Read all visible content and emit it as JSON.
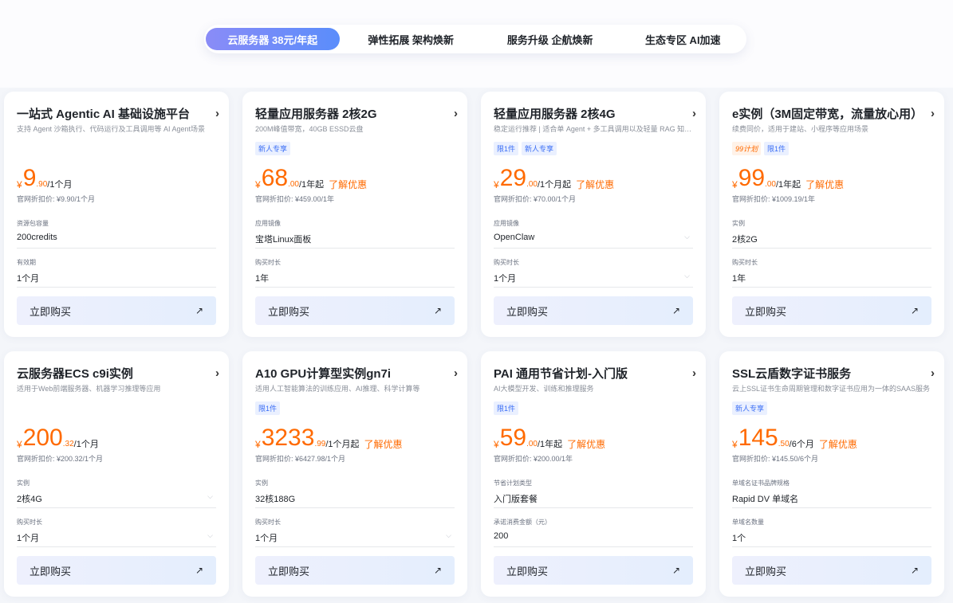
{
  "tabs": [
    {
      "label": "云服务器 38元/年起",
      "active": true
    },
    {
      "label": "弹性拓展 架构焕新",
      "active": false
    },
    {
      "label": "服务升级 企航焕新",
      "active": false
    },
    {
      "label": "生态专区 AI加速",
      "active": false
    }
  ],
  "buy_label": "立即购买",
  "cards": [
    {
      "title": "一站式 Agentic AI 基础设施平台",
      "desc": "支持 Agent 沙箱执行、代码运行及工具调用等 AI Agent场景",
      "tags": [],
      "price": {
        "currency": "¥",
        "int": "9",
        "dec": ".90",
        "unit": "/1个月",
        "promo": ""
      },
      "orig": "官网折扣价: ¥9.90/1个月",
      "fields": [
        {
          "label": "资源包容量",
          "value": "200credits",
          "dropdown": false
        },
        {
          "label": "有效期",
          "value": "1个月",
          "dropdown": false
        }
      ]
    },
    {
      "title": "轻量应用服务器 2核2G",
      "desc": "200M峰值带宽，40GB ESSD云盘",
      "tags": [
        {
          "text": "新人专享",
          "style": "blue"
        }
      ],
      "price": {
        "currency": "¥",
        "int": "68",
        "dec": ".00",
        "unit": "/1年起",
        "promo": "了解优惠"
      },
      "orig": "官网折扣价: ¥459.00/1年",
      "fields": [
        {
          "label": "应用镜像",
          "value": "宝塔Linux面板",
          "dropdown": false
        },
        {
          "label": "购买时长",
          "value": "1年",
          "dropdown": false
        }
      ]
    },
    {
      "title": "轻量应用服务器 2核4G",
      "desc": "稳定运行推荐 | 适合单 Agent + 多工具调用以及轻量 RAG 知识库场景",
      "tags": [
        {
          "text": "限1件",
          "style": "blue"
        },
        {
          "text": "新人专享",
          "style": "blue"
        }
      ],
      "price": {
        "currency": "¥",
        "int": "29",
        "dec": ".00",
        "unit": "/1个月起",
        "promo": "了解优惠"
      },
      "orig": "官网折扣价: ¥70.00/1个月",
      "fields": [
        {
          "label": "应用镜像",
          "value": "OpenClaw",
          "dropdown": true
        },
        {
          "label": "购买时长",
          "value": "1个月",
          "dropdown": true
        }
      ]
    },
    {
      "title": "e实例（3M固定带宽，流量放心用）",
      "desc": "续费同价，适用于建站、小程序等应用场景",
      "tags": [
        {
          "text": "99计划",
          "style": "orange"
        },
        {
          "text": "限1件",
          "style": "blue"
        }
      ],
      "price": {
        "currency": "¥",
        "int": "99",
        "dec": ".00",
        "unit": "/1年起",
        "promo": "了解优惠"
      },
      "orig": "官网折扣价: ¥1009.19/1年",
      "fields": [
        {
          "label": "实例",
          "value": "2核2G",
          "dropdown": false
        },
        {
          "label": "购买时长",
          "value": "1年",
          "dropdown": false
        }
      ]
    },
    {
      "title": "云服务器ECS c9i实例",
      "desc": "适用于Web前端服务器、机器学习推理等应用",
      "tags": [],
      "price": {
        "currency": "¥",
        "int": "200",
        "dec": ".32",
        "unit": "/1个月",
        "promo": ""
      },
      "orig": "官网折扣价: ¥200.32/1个月",
      "fields": [
        {
          "label": "实例",
          "value": "2核4G",
          "dropdown": true
        },
        {
          "label": "购买时长",
          "value": "1个月",
          "dropdown": true
        }
      ]
    },
    {
      "title": "A10 GPU计算型实例gn7i",
      "desc": "适用人工智能算法的训练应用、AI推理、科学计算等",
      "tags": [
        {
          "text": "限1件",
          "style": "blue"
        }
      ],
      "price": {
        "currency": "¥",
        "int": "3233",
        "dec": ".99",
        "unit": "/1个月起",
        "promo": "了解优惠"
      },
      "orig": "官网折扣价: ¥6427.98/1个月",
      "fields": [
        {
          "label": "实例",
          "value": "32核188G",
          "dropdown": false
        },
        {
          "label": "购买时长",
          "value": "1个月",
          "dropdown": true
        }
      ]
    },
    {
      "title": "PAI 通用节省计划-入门版",
      "desc": "AI大模型开发、训练和推理服务",
      "tags": [
        {
          "text": "限1件",
          "style": "blue"
        }
      ],
      "price": {
        "currency": "¥",
        "int": "59",
        "dec": ".00",
        "unit": "/1年起",
        "promo": "了解优惠"
      },
      "orig": "官网折扣价: ¥200.00/1年",
      "fields": [
        {
          "label": "节省计划类型",
          "value": "入门版套餐",
          "dropdown": false
        },
        {
          "label": "承诺消费金额（元）",
          "value": "200",
          "dropdown": false
        }
      ]
    },
    {
      "title": "SSL云盾数字证书服务",
      "desc": "云上SSL证书生命周期管理和数字证书应用为一体的SAAS服务",
      "tags": [
        {
          "text": "新人专享",
          "style": "blue"
        }
      ],
      "price": {
        "currency": "¥",
        "int": "145",
        "dec": ".50",
        "unit": "/6个月",
        "promo": "了解优惠"
      },
      "orig": "官网折扣价: ¥145.50/6个月",
      "fields": [
        {
          "label": "单域名证书品牌规格",
          "value": "Rapid DV 单域名",
          "dropdown": false
        },
        {
          "label": "单域名数量",
          "value": "1个",
          "dropdown": false
        }
      ]
    }
  ]
}
